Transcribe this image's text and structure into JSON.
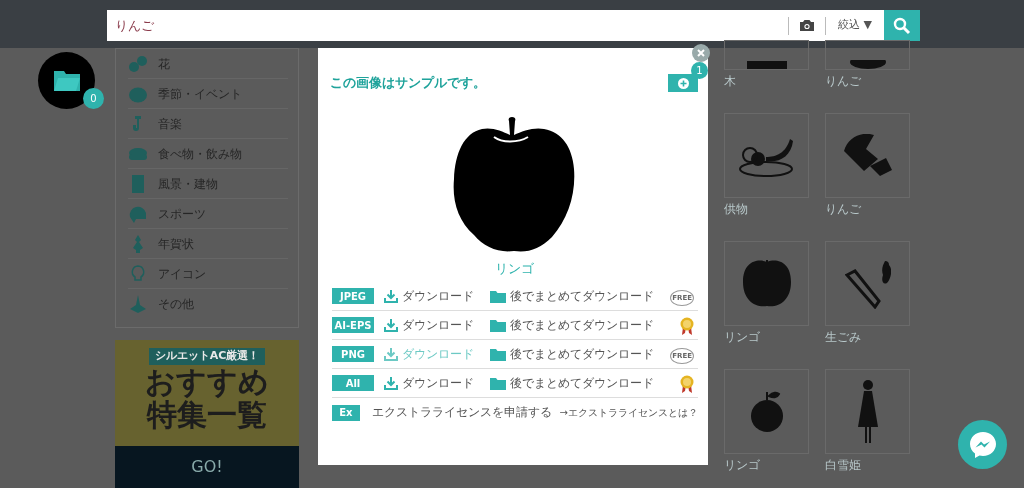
{
  "search": {
    "value": "りんご",
    "filter_label": "絞込 ▼"
  },
  "collection": {
    "count": "0"
  },
  "categories": [
    {
      "label": "花"
    },
    {
      "label": "季節・イベント"
    },
    {
      "label": "音楽"
    },
    {
      "label": "食べ物・飲み物"
    },
    {
      "label": "風景・建物"
    },
    {
      "label": "スポーツ"
    },
    {
      "label": "年賀状"
    },
    {
      "label": "アイコン"
    },
    {
      "label": "その他"
    }
  ],
  "banner": {
    "tag": "シルエットAC厳選！",
    "line_1": "おすすめ",
    "line_2": "特集一覧",
    "button": "GO!"
  },
  "modal": {
    "notice": "この画像はサンプルです。",
    "add_count": "1",
    "title": "リンゴ",
    "downloads": [
      {
        "format": "JPEG",
        "download": "ダウンロード",
        "later": "後でまとめてダウンロード",
        "highlighted": false,
        "license": {
          "kind": "free",
          "label": "FREE"
        }
      },
      {
        "format": "AI-EPS",
        "download": "ダウンロード",
        "later": "後でまとめてダウンロード",
        "highlighted": false,
        "license": {
          "kind": "premium"
        }
      },
      {
        "format": "PNG",
        "download": "ダウンロード",
        "later": "後でまとめてダウンロード",
        "highlighted": true,
        "license": {
          "kind": "free",
          "label": "FREE"
        }
      },
      {
        "format": "All",
        "download": "ダウンロード",
        "later": "後でまとめてダウンロード",
        "highlighted": false,
        "license": {
          "kind": "premium"
        }
      }
    ],
    "extra": {
      "format": "Ex",
      "apply": "エクストラライセンスを申請する",
      "link": "→エクストラライセンスとは？"
    }
  },
  "results": [
    {
      "caption": "木"
    },
    {
      "caption": "りんご"
    },
    {
      "caption": "供物"
    },
    {
      "caption": "りんご"
    },
    {
      "caption": "リンゴ"
    },
    {
      "caption": "生ごみ"
    },
    {
      "caption": "リンゴ"
    },
    {
      "caption": "白雪姫"
    }
  ]
}
